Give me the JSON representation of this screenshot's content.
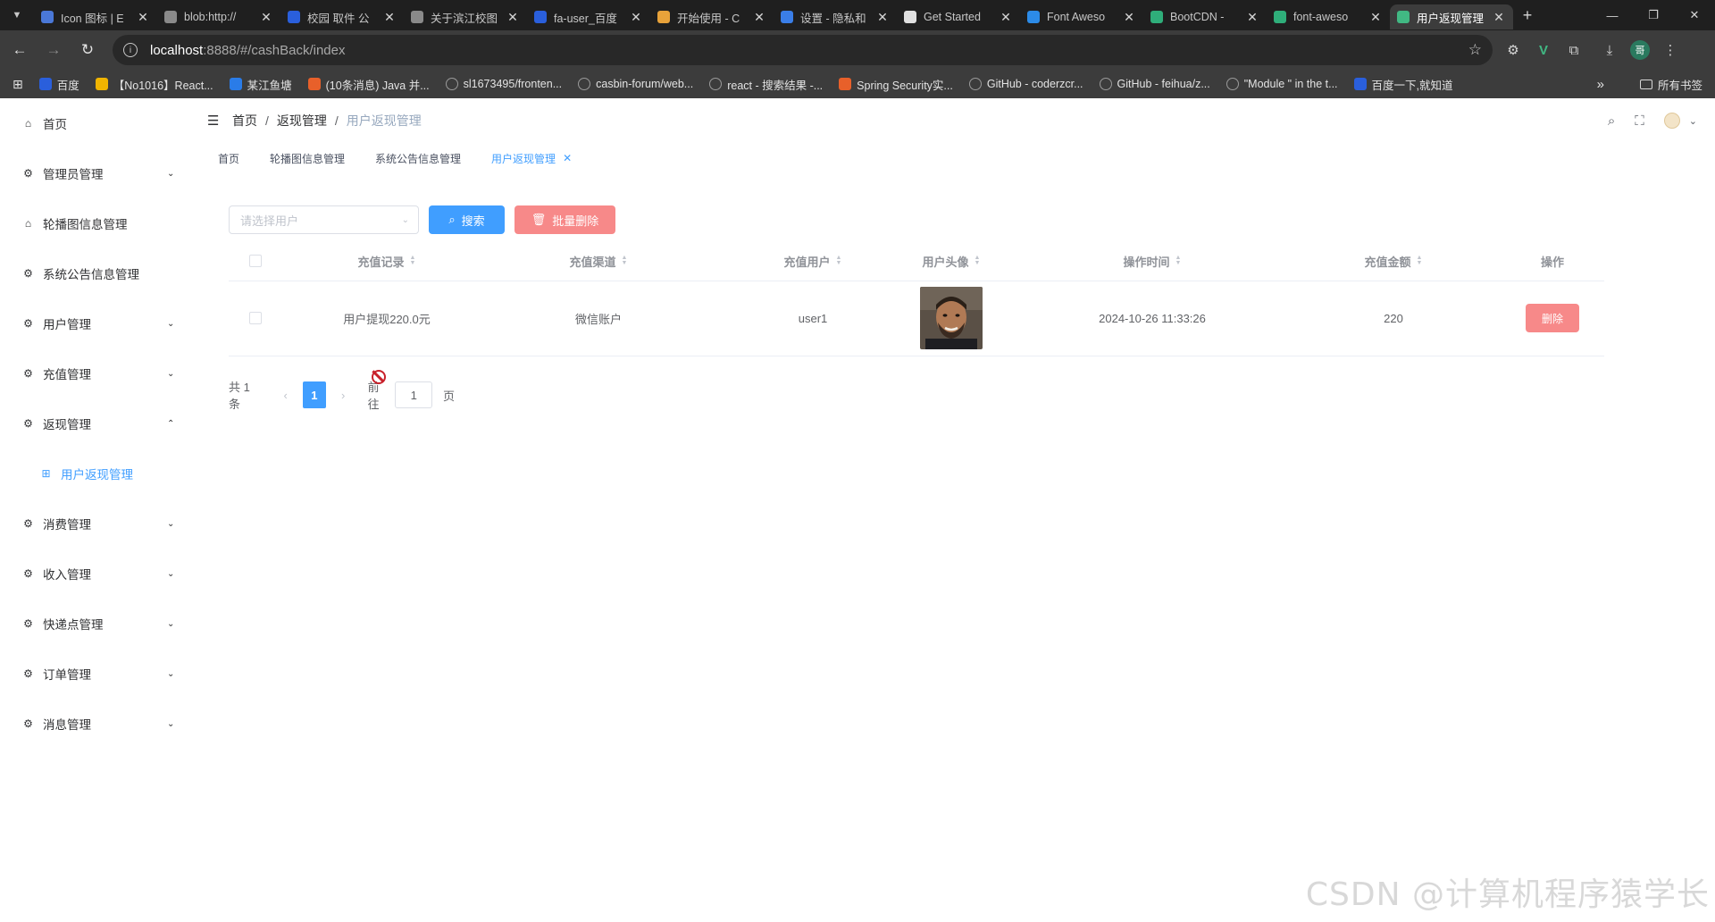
{
  "browser": {
    "tabs": [
      {
        "title": "Icon 图标 | E",
        "color": "#4a78d8"
      },
      {
        "title": "blob:http://",
        "color": "#8a8a8a"
      },
      {
        "title": "校园 取件 公",
        "color": "#2a5fdc"
      },
      {
        "title": "关于滨江校图",
        "color": "#8a8a8a"
      },
      {
        "title": "fa-user_百度",
        "color": "#2a5fdc"
      },
      {
        "title": "开始使用 - C",
        "color": "#e8a23a"
      },
      {
        "title": "设置 - 隐私和",
        "color": "#3a7ee8"
      },
      {
        "title": "Get Started",
        "color": "#e0e0e0"
      },
      {
        "title": "Font Aweso",
        "color": "#2c8be8"
      },
      {
        "title": "BootCDN -",
        "color": "#2fae7a"
      },
      {
        "title": "font-aweso",
        "color": "#2fae7a"
      },
      {
        "title": "用户返现管理",
        "color": "#41b883"
      }
    ],
    "url_host": "localhost",
    "url_path": ":8888/#/cashBack/index",
    "bookmarks": [
      {
        "label": "百度",
        "color": "#2a5fdc"
      },
      {
        "label": "【No1016】React...",
        "color": "#f0b400"
      },
      {
        "label": "某江鱼塘",
        "color": "#2a7ce8"
      },
      {
        "label": "(10条消息) Java 并...",
        "color": "#e8602a"
      },
      {
        "label": "sl1673495/fronten...",
        "color": ""
      },
      {
        "label": "casbin-forum/web...",
        "color": ""
      },
      {
        "label": "react - 搜索结果 -...",
        "color": ""
      },
      {
        "label": "Spring Security实...",
        "color": "#e8602a"
      },
      {
        "label": "GitHub - coderzcr...",
        "color": ""
      },
      {
        "label": "GitHub - feihua/z...",
        "color": ""
      },
      {
        "label": "\"Module \" in the t...",
        "color": ""
      },
      {
        "label": "百度一下,就知道",
        "color": "#2a5fdc"
      }
    ],
    "all_bookmarks": "所有书签",
    "profile_initial": "哥"
  },
  "sidebar": {
    "items": [
      {
        "label": "首页",
        "icon": "home-icon",
        "chevron": ""
      },
      {
        "label": "管理员管理",
        "icon": "gear-icon",
        "chevron": "down"
      },
      {
        "label": "轮播图信息管理",
        "icon": "home-icon",
        "chevron": ""
      },
      {
        "label": "系统公告信息管理",
        "icon": "gear-icon",
        "chevron": ""
      },
      {
        "label": "用户管理",
        "icon": "gear-icon",
        "chevron": "down"
      },
      {
        "label": "充值管理",
        "icon": "gear-icon",
        "chevron": "down"
      },
      {
        "label": "返现管理",
        "icon": "gear-icon",
        "chevron": "up"
      },
      {
        "label": "用户返现管理",
        "icon": "grid-icon",
        "chevron": ""
      },
      {
        "label": "消费管理",
        "icon": "gear-icon",
        "chevron": "down"
      },
      {
        "label": "收入管理",
        "icon": "gear-icon",
        "chevron": "down"
      },
      {
        "label": "快递点管理",
        "icon": "gear-icon",
        "chevron": "down"
      },
      {
        "label": "订单管理",
        "icon": "gear-icon",
        "chevron": "down"
      },
      {
        "label": "消息管理",
        "icon": "gear-icon",
        "chevron": "down"
      }
    ]
  },
  "header": {
    "breadcrumb": [
      "首页",
      "返现管理",
      "用户返现管理"
    ]
  },
  "tags": [
    "首页",
    "轮播图信息管理",
    "系统公告信息管理",
    "用户返现管理"
  ],
  "toolbar": {
    "select_placeholder": "请选择用户",
    "search_label": "搜索",
    "batch_delete_label": "批量删除"
  },
  "table": {
    "columns": [
      "充值记录",
      "充值渠道",
      "充值用户",
      "用户头像",
      "操作时间",
      "充值金额",
      "操作"
    ],
    "rows": [
      {
        "record": "用户提现220.0元",
        "channel": "微信账户",
        "user": "user1",
        "time": "2024-10-26 11:33:26",
        "amount": "220",
        "action": "删除"
      }
    ]
  },
  "pagination": {
    "total": "共 1 条",
    "current": "1",
    "goto_label": "前往",
    "goto_value": "1",
    "page_suffix": "页"
  },
  "watermark": "CSDN @计算机程序猿学长",
  "colors": {
    "primary": "#409eff",
    "danger": "#f78989"
  }
}
